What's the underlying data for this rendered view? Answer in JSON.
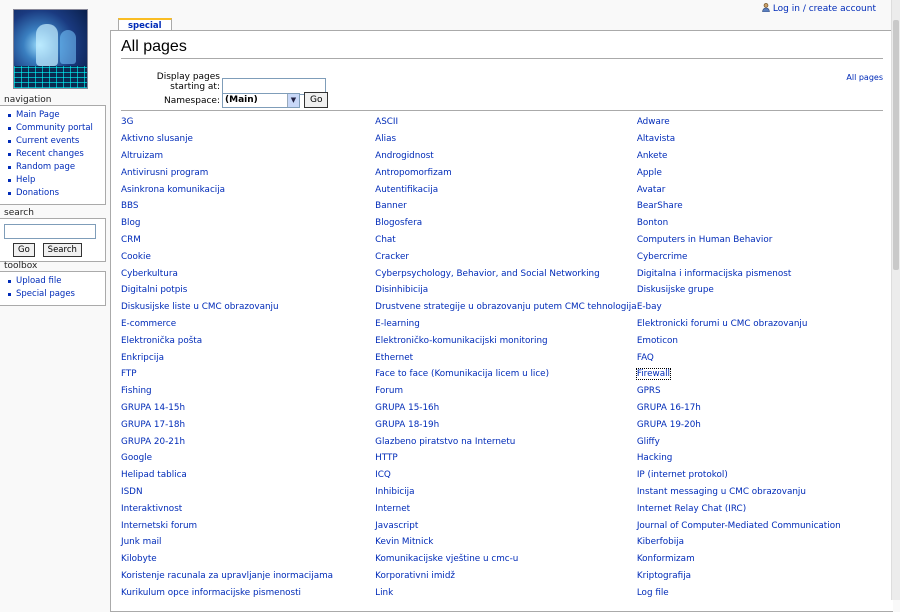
{
  "personal": {
    "login_label": "Log in / create account"
  },
  "navigation": {
    "heading": "navigation",
    "items": [
      "Main Page",
      "Community portal",
      "Current events",
      "Recent changes",
      "Random page",
      "Help",
      "Donations"
    ]
  },
  "search": {
    "heading": "search",
    "input_value": "",
    "go_label": "Go",
    "search_label": "Search"
  },
  "toolbox": {
    "heading": "toolbox",
    "items": [
      "Upload file",
      "Special pages"
    ]
  },
  "tab": {
    "label": "special"
  },
  "page": {
    "title": "All pages",
    "all_pages_link": "All pages",
    "from_label": "Display pages starting at:",
    "from_value": "",
    "namespace_label": "Namespace:",
    "namespace_value": "(Main)",
    "go_label": "Go"
  },
  "pages": [
    [
      "3G",
      "ASCII",
      "Adware"
    ],
    [
      "Aktivno slusanje",
      "Alias",
      "Altavista"
    ],
    [
      "Altruizam",
      "Androgidnost",
      "Ankete"
    ],
    [
      "Antivirusni program",
      "Antropomorfizam",
      "Apple"
    ],
    [
      "Asinkrona komunikacija",
      "Autentifikacija",
      "Avatar"
    ],
    [
      "BBS",
      "Banner",
      "BearShare"
    ],
    [
      "Blog",
      "Blogosfera",
      "Bonton"
    ],
    [
      "CRM",
      "Chat",
      "Computers in Human Behavior"
    ],
    [
      "Cookie",
      "Cracker",
      "Cybercrime"
    ],
    [
      "Cyberkultura",
      "Cyberpsychology, Behavior, and Social Networking",
      "Digitalna i informacijska pismenost"
    ],
    [
      "Digitalni potpis",
      "Disinhibicija",
      "Diskusijske grupe"
    ],
    [
      "Diskusijske liste u CMC obrazovanju",
      "Drustvene strategije u obrazovanju putem CMC tehnologija",
      "E-bay"
    ],
    [
      "E-commerce",
      "E-learning",
      "Elektronicki forumi u CMC obrazovanju"
    ],
    [
      "Elektronička pošta",
      "Elektroničko-komunikacijski monitoring",
      "Emoticon"
    ],
    [
      "Enkripcija",
      "Ethernet",
      "FAQ"
    ],
    [
      "FTP",
      "Face to face (Komunikacija licem u lice)",
      "Firewall"
    ],
    [
      "Fishing",
      "Forum",
      "GPRS"
    ],
    [
      "GRUPA 14-15h",
      "GRUPA 15-16h",
      "GRUPA 16-17h"
    ],
    [
      "GRUPA 17-18h",
      "GRUPA 18-19h",
      "GRUPA 19-20h"
    ],
    [
      "GRUPA 20-21h",
      "Glazbeno piratstvo na Internetu",
      "Gliffy"
    ],
    [
      "Google",
      "HTTP",
      "Hacking"
    ],
    [
      "Helipad tablica",
      "ICQ",
      "IP (internet protokol)"
    ],
    [
      "ISDN",
      "Inhibicija",
      "Instant messaging u CMC obrazovanju"
    ],
    [
      "Interaktivnost",
      "Internet",
      "Internet Relay Chat (IRC)"
    ],
    [
      "Internetski forum",
      "Javascript",
      "Journal of Computer-Mediated Communication"
    ],
    [
      "Junk mail",
      "Kevin Mitnick",
      "Kiberfobija"
    ],
    [
      "Kilobyte",
      "Komunikacijske vještine u cmc-u",
      "Konformizam"
    ],
    [
      "Koristenje racunala za upravljanje inormacijama",
      "Korporativni imidž",
      "Kriptografija"
    ],
    [
      "Kurikulum opce informacijske pismenosti",
      "Link",
      "Log file"
    ]
  ],
  "selected_page": "Firewall",
  "icons": {
    "user": "user-icon",
    "dropdown": "chevron-down-icon"
  },
  "colors": {
    "link": "#002bb8",
    "tab_accent": "#fabd23",
    "background": "#f9f9f9"
  }
}
